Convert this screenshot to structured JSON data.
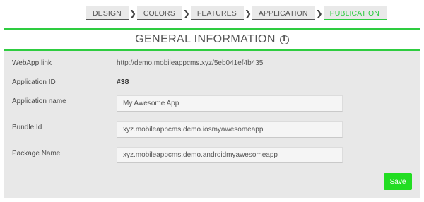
{
  "wizard": {
    "steps": [
      {
        "label": "DESIGN",
        "active": false
      },
      {
        "label": "COLORS",
        "active": false
      },
      {
        "label": "FEATURES",
        "active": false
      },
      {
        "label": "APPLICATION",
        "active": false
      },
      {
        "label": "PUBLICATION",
        "active": true
      }
    ],
    "separator": "❯"
  },
  "panel": {
    "title": "GENERAL INFORMATION",
    "title_icon": "info-icon",
    "accent_color": "#2ecc40",
    "rows": {
      "webapp_link": {
        "label": "WebApp link",
        "value": "http://demo.mobileappcms.xyz/5eb041ef4b435"
      },
      "application_id": {
        "label": "Application ID",
        "value": "#38"
      },
      "application_name": {
        "label": "Application name",
        "value": "My Awesome App"
      },
      "bundle_id": {
        "label": "Bundle Id",
        "value": "xyz.mobileappcms.demo.iosmyawesomeapp"
      },
      "package_name": {
        "label": "Package Name",
        "value": "xyz.mobileappcms.demo.androidmyawesomeapp"
      }
    },
    "save_label": "Save",
    "save_color": "#22dd22"
  }
}
